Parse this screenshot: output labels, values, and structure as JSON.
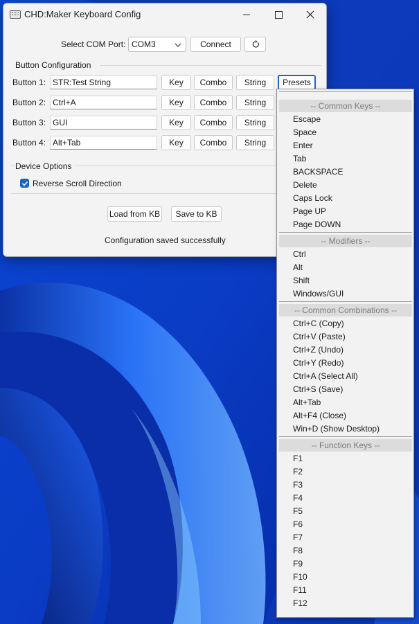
{
  "window": {
    "title": "CHD:Maker Keyboard Config"
  },
  "com": {
    "label": "Select COM Port:",
    "selected": "COM3",
    "connect_label": "Connect",
    "refresh_icon": "refresh-icon"
  },
  "button_config": {
    "group_label": "Button Configuration",
    "rows": [
      {
        "label": "Button 1:",
        "value": "STR:Test String"
      },
      {
        "label": "Button 2:",
        "value": "Ctrl+A"
      },
      {
        "label": "Button 3:",
        "value": "GUI"
      },
      {
        "label": "Button 4:",
        "value": "Alt+Tab"
      }
    ],
    "key_label": "Key",
    "combo_label": "Combo",
    "string_label": "String",
    "presets_label": "Presets"
  },
  "device_options": {
    "group_label": "Device Options",
    "reverse_scroll_label": "Reverse Scroll Direction",
    "reverse_scroll_checked": true
  },
  "actions": {
    "load_label": "Load from KB",
    "save_label": "Save to KB",
    "status": "Configuration saved successfully"
  },
  "presets_menu": {
    "sections": [
      {
        "header": "-- Common Keys --",
        "items": [
          "Escape",
          "Space",
          "Enter",
          "Tab",
          "BACKSPACE",
          "Delete",
          "Caps Lock",
          "Page UP",
          "Page DOWN"
        ]
      },
      {
        "header": "-- Modifiers --",
        "items": [
          "Ctrl",
          "Alt",
          "Shift",
          "Windows/GUI"
        ]
      },
      {
        "header": "-- Common Combinations --",
        "items": [
          "Ctrl+C (Copy)",
          "Ctrl+V (Paste)",
          "Ctrl+Z (Undo)",
          "Ctrl+Y (Redo)",
          "Ctrl+A (Select All)",
          "Ctrl+S (Save)",
          "Alt+Tab",
          "Alt+F4 (Close)",
          "Win+D (Show Desktop)"
        ]
      },
      {
        "header": "-- Function Keys --",
        "items": [
          "F1",
          "F2",
          "F3",
          "F4",
          "F5",
          "F6",
          "F7",
          "F8",
          "F9",
          "F10",
          "F11",
          "F12"
        ]
      }
    ]
  },
  "colors": {
    "accent": "#1c63c9",
    "wallpaper": "#0a3fc8"
  }
}
